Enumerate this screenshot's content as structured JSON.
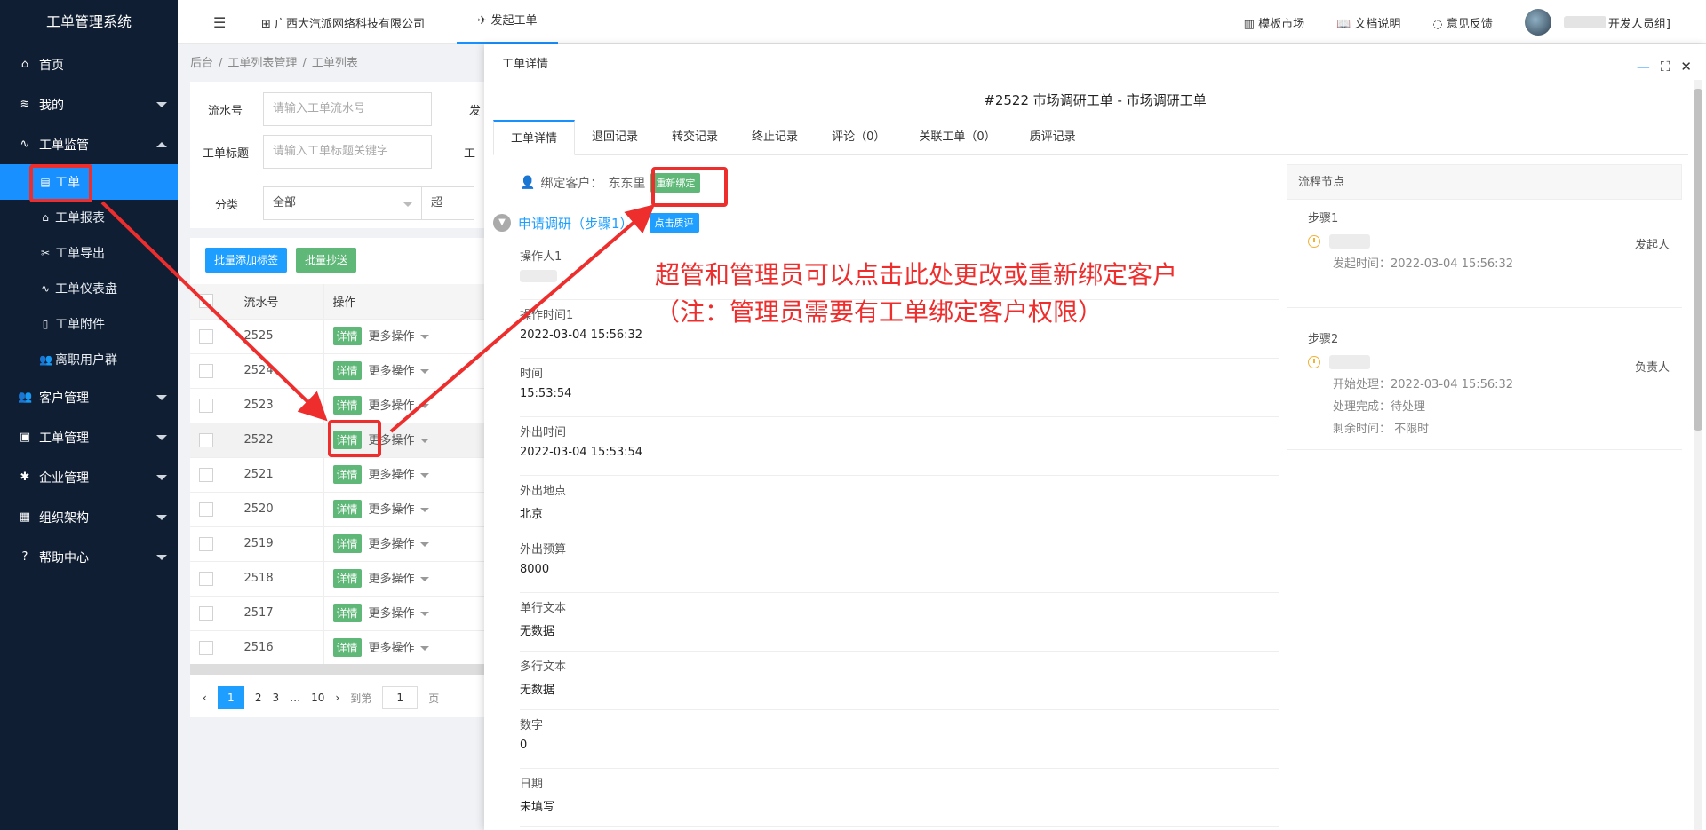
{
  "app": {
    "title": "工单管理系统"
  },
  "sidebar": {
    "items": [
      {
        "icon": "home-icon",
        "label": "首页"
      },
      {
        "icon": "layers-icon",
        "label": "我的"
      },
      {
        "icon": "pulse-icon",
        "label": "工单监管"
      },
      {
        "icon": "users-icon",
        "label": "客户管理"
      },
      {
        "icon": "clipboard-icon",
        "label": "工单管理"
      },
      {
        "icon": "gear-icon",
        "label": "企业管理"
      },
      {
        "icon": "calendar-icon",
        "label": "组织架构"
      },
      {
        "icon": "question-icon",
        "label": "帮助中心"
      }
    ],
    "sub_items": [
      {
        "icon": "doc-icon",
        "label": "工单",
        "active": true
      },
      {
        "icon": "home-icon",
        "label": "工单报表"
      },
      {
        "icon": "tools-icon",
        "label": "工单导出"
      },
      {
        "icon": "pulse-icon",
        "label": "工单仪表盘"
      },
      {
        "icon": "file-icon",
        "label": "工单附件"
      },
      {
        "icon": "users-icon",
        "label": "离职用户群"
      }
    ]
  },
  "topbar": {
    "org": "广西大汽派网络科技有限公司",
    "launch_tab": "发起工单",
    "links": {
      "templates": "模板市场",
      "docs": "文档说明",
      "feedback": "意见反馈"
    },
    "user_suffix": "开发人员组]"
  },
  "breadcrumb": [
    "后台",
    "工单列表管理",
    "工单列表"
  ],
  "filters": {
    "serial_label": "流水号",
    "serial_placeholder": "请输入工单流水号",
    "title_label": "工单标题",
    "title_placeholder": "请输入工单标题关键字",
    "category_label": "分类",
    "category_value": "全部",
    "cut_label_1": "发",
    "cut_label_2": "工",
    "cut_label_3": "超"
  },
  "list": {
    "batch_tag": "批量添加标签",
    "batch_cc": "批量抄送",
    "col_serial": "流水号",
    "col_op": "操作",
    "detail_label": "详情",
    "more_label": "更多操作",
    "rows": [
      "2525",
      "2524",
      "2523",
      "2522",
      "2521",
      "2520",
      "2519",
      "2518",
      "2517",
      "2516"
    ],
    "pager": {
      "current": "1",
      "p2": "2",
      "p3": "3",
      "ellipsis": "…",
      "last": "10",
      "goto": "到第",
      "page_input": "1",
      "page_unit": "页"
    }
  },
  "drawer": {
    "header": "工单详情",
    "title": "#2522 市场调研工单 - 市场调研工单",
    "tabs": [
      "工单详情",
      "退回记录",
      "转交记录",
      "终止记录",
      "评论（0）",
      "关联工单（0）",
      "质评记录"
    ],
    "bind_label": "绑定客户：",
    "bind_value": "东东里",
    "rebind_button": "重新绑定",
    "step_name": "申请调研（步骤1）",
    "rate_button": "点击质评",
    "fields": [
      {
        "k": "操作人1",
        "v": ""
      },
      {
        "k": "操作时间1",
        "v": "2022-03-04 15:56:32"
      },
      {
        "k": "时间",
        "v": "15:53:54"
      },
      {
        "k": "外出时间",
        "v": "2022-03-04 15:53:54"
      },
      {
        "k": "外出地点",
        "v": "北京"
      },
      {
        "k": "外出预算",
        "v": "8000"
      },
      {
        "k": "单行文本",
        "v": "无数据"
      },
      {
        "k": "多行文本",
        "v": "无数据"
      },
      {
        "k": "数字",
        "v": "0"
      },
      {
        "k": "日期",
        "v": "未填写"
      }
    ],
    "flow": {
      "header": "流程节点",
      "step1": {
        "label": "步骤1",
        "role": "发起人",
        "line1": "发起时间：2022-03-04 15:56:32"
      },
      "step2": {
        "label": "步骤2",
        "role": "负责人",
        "line1": "开始处理：2022-03-04 15:56:32",
        "line2": "处理完成：待处理",
        "line3": "剩余时间：  不限时"
      }
    }
  },
  "annotation": {
    "line1": "超管和管理员可以点击此处更改或重新绑定客户",
    "line2": "（注：管理员需要有工单绑定客户权限）",
    "color": "#ee2d2d"
  }
}
